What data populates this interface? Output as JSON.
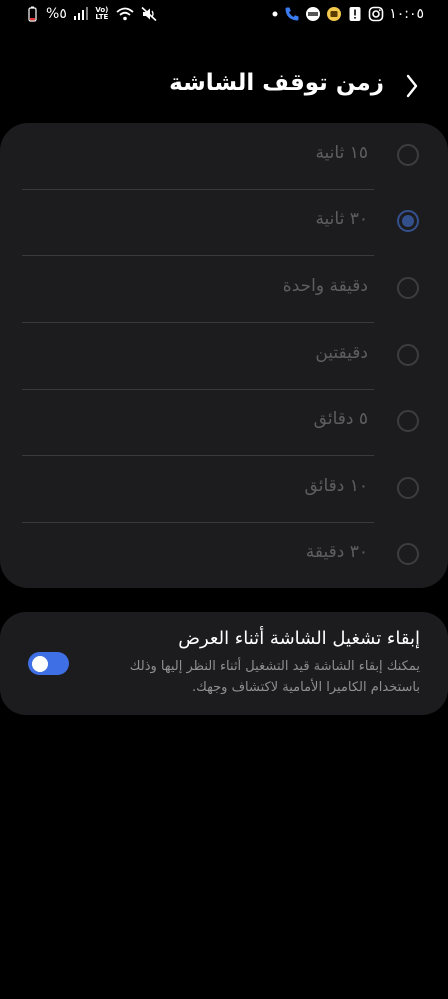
{
  "status_bar": {
    "time": "١٠:٠٥",
    "battery_percent": "%٥",
    "network_top": "Vo)",
    "network_bottom": "LTE",
    "icons": [
      "battery-icon",
      "signal-icon",
      "volte-icon",
      "wifi-icon",
      "mute-icon",
      "dot-icon",
      "call-icon",
      "app-badge-icon",
      "media-icon",
      "alert-icon",
      "instagram-icon"
    ]
  },
  "header": {
    "title": "زمن توقف الشاشة",
    "back_icon": "chevron-right-icon"
  },
  "timeout_options": {
    "selected_index": 1,
    "items": [
      {
        "label": "١٥ ثانية"
      },
      {
        "label": "٣٠ ثانية"
      },
      {
        "label": "دقيقة واحدة"
      },
      {
        "label": "دقيقتين"
      },
      {
        "label": "٥ دقائق"
      },
      {
        "label": "١٠ دقائق"
      },
      {
        "label": "٣٠ دقيقة"
      }
    ]
  },
  "keep_screen_on": {
    "title": "إبقاء تشغيل الشاشة أثناء العرض",
    "description": "يمكنك إبقاء الشاشة قيد التشغيل أثناء النظر إليها وذلك باستخدام الكاميرا الأمامية لاكتشاف وجهك.",
    "enabled": true
  },
  "colors": {
    "background": "#000000",
    "card": "#1c1c1e",
    "accent": "#3e6fe4",
    "selected_radio": "#34508c",
    "dimmed_text": "#5e5e62"
  }
}
